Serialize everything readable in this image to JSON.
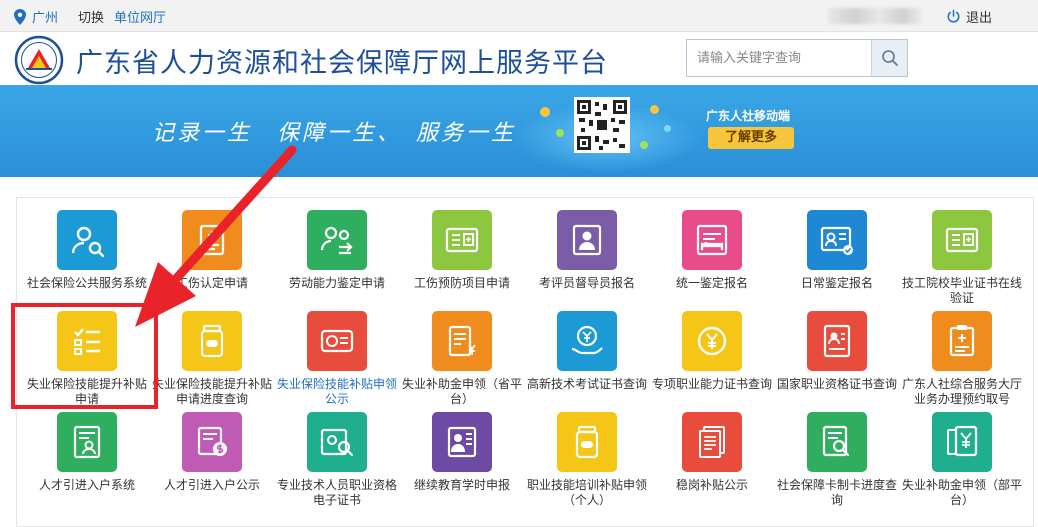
{
  "topbar": {
    "city": "广州",
    "switch_label": "切换",
    "unit_link": "单位网厅",
    "logout_label": "退出"
  },
  "header": {
    "title": "广东省人力资源和社会保障厅网上服务平台",
    "search_placeholder": "请输入关键字查询"
  },
  "banner": {
    "slogan": "记录一生　保障一生、　服务一生",
    "mobile_title": "广东人社移动端",
    "more_button": "了解更多"
  },
  "colors": {
    "brand_blue": "#1d4f9a",
    "banner_blue": "#2a8fd8",
    "highlight_red": "#e8232a"
  },
  "services": [
    {
      "label": "社会保险公共服务系统",
      "color": "#1b9ad6",
      "icon": "user-search-icon"
    },
    {
      "label": "工伤认定申请",
      "color": "#f08c1e",
      "icon": "medical-form-icon"
    },
    {
      "label": "劳动能力鉴定申请",
      "color": "#2fae5f",
      "icon": "people-exchange-icon"
    },
    {
      "label": "工伤预防项目申请",
      "color": "#8dc63f",
      "icon": "id-card-icon"
    },
    {
      "label": "考评员督导员报名",
      "color": "#7b5ca8",
      "icon": "person-board-icon"
    },
    {
      "label": "统一鉴定报名",
      "color": "#e84c8b",
      "icon": "bed-list-icon"
    },
    {
      "label": "日常鉴定报名",
      "color": "#1e88d4",
      "icon": "id-badge-icon"
    },
    {
      "label": "技工院校毕业证书在线验证",
      "color": "#8dc63f",
      "icon": "certificate-icon"
    },
    {
      "label": "失业保险技能提升补贴申请",
      "color": "#f5c518",
      "icon": "checklist-icon"
    },
    {
      "label": "失业保险技能提升补贴申请进度查询",
      "color": "#f5c518",
      "icon": "pill-bottle-icon"
    },
    {
      "label": "失业保险技能补贴申领公示",
      "color": "#e84c3d",
      "icon": "social-card-icon"
    },
    {
      "label": "失业补助金申领（省平台）",
      "color": "#f08c1e",
      "icon": "document-yuan-icon"
    },
    {
      "label": "高新技术考试证书查询",
      "color": "#1b9ad6",
      "icon": "hand-yuan-icon"
    },
    {
      "label": "专项职业能力证书查询",
      "color": "#f5c518",
      "icon": "coin-yuan-icon"
    },
    {
      "label": "国家职业资格证书查询",
      "color": "#e84c3d",
      "icon": "profile-card-icon"
    },
    {
      "label": "广东人社综合服务大厅业务办理预约取号",
      "color": "#f08c1e",
      "icon": "clipboard-plus-icon"
    },
    {
      "label": "人才引进入户系统",
      "color": "#2fae5f",
      "icon": "resume-icon"
    },
    {
      "label": "人才引进入户公示",
      "color": "#c05bb5",
      "icon": "dollar-card-icon"
    },
    {
      "label": "专业技术人员职业资格电子证书",
      "color": "#1fae8e",
      "icon": "card-search-icon"
    },
    {
      "label": "继续教育学时申报",
      "color": "#6d4aa3",
      "icon": "teacher-board-icon"
    },
    {
      "label": "职业技能培训补贴申领（个人）",
      "color": "#f5c518",
      "icon": "medicine-jar-icon"
    },
    {
      "label": "稳岗补贴公示",
      "color": "#e84c3d",
      "icon": "stacked-docs-icon"
    },
    {
      "label": "社会保障卡制卡进度查询",
      "color": "#2fae5f",
      "icon": "doc-search-icon"
    },
    {
      "label": "失业补助金申领（部平台）",
      "color": "#1fae8e",
      "icon": "yuan-docs-icon"
    }
  ]
}
